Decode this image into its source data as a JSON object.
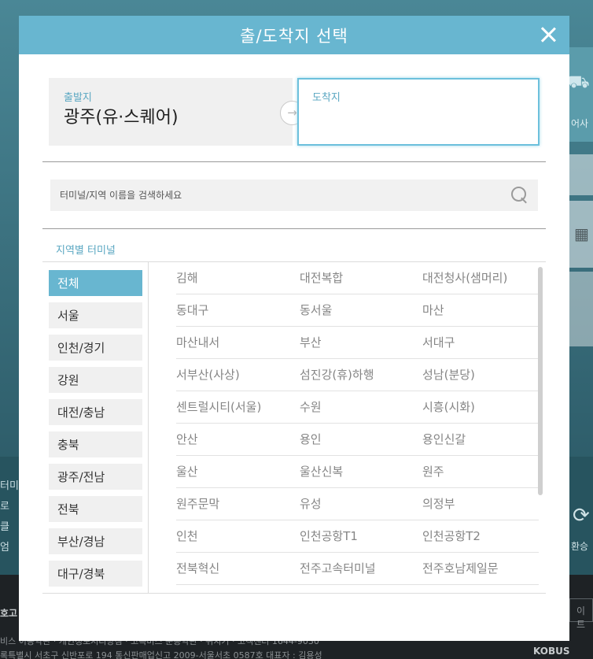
{
  "background": {
    "right_label": "어사",
    "left_text": [
      "터미",
      "로",
      "클",
      "엄"
    ],
    "right_refresh_label": "환승",
    "footer_title": "호고",
    "footer_line1": "비스 이용약관 · 개인정보처리방침 · 고속버스 운송약관 · 위치기 · 고객센터 1644-9030",
    "footer_line2": "록특별시 서초구 신반포로 194 통신판매업신고 2009-서울서초 0587호 대표자 : 김용성",
    "footer_input": "이트",
    "logo": "KOBUS"
  },
  "modal": {
    "title": "출/도착지 선택",
    "origin": {
      "label": "출발지",
      "value": "광주(유·스퀘어)"
    },
    "arrow": "→",
    "destination": {
      "label": "도착지",
      "value": ""
    },
    "search": {
      "placeholder": "터미널/지역 이름을 검색하세요"
    },
    "section_title": "지역별 터미널",
    "regions": [
      {
        "label": "전체",
        "active": true
      },
      {
        "label": "서울",
        "active": false
      },
      {
        "label": "인천/경기",
        "active": false
      },
      {
        "label": "강원",
        "active": false
      },
      {
        "label": "대전/충남",
        "active": false
      },
      {
        "label": "충북",
        "active": false
      },
      {
        "label": "광주/전남",
        "active": false
      },
      {
        "label": "전북",
        "active": false
      },
      {
        "label": "부산/경남",
        "active": false
      },
      {
        "label": "대구/경북",
        "active": false
      }
    ],
    "terminals": [
      [
        "김해",
        "대전복합",
        "대전청사(샘머리)"
      ],
      [
        "동대구",
        "동서울",
        "마산"
      ],
      [
        "마산내서",
        "부산",
        "서대구"
      ],
      [
        "서부산(사상)",
        "섬진강(휴)하행",
        "성남(분당)"
      ],
      [
        "센트럴시티(서울)",
        "수원",
        "시흥(시화)"
      ],
      [
        "안산",
        "용인",
        "용인신갈"
      ],
      [
        "울산",
        "울산신복",
        "원주"
      ],
      [
        "원주문막",
        "유성",
        "의정부"
      ],
      [
        "인천",
        "인천공항T1",
        "인천공항T2"
      ],
      [
        "전북혁신",
        "전주고속터미널",
        "전주호남제일문"
      ]
    ],
    "colors": {
      "accent": "#68b6d0",
      "label": "#5aa7c2"
    }
  }
}
